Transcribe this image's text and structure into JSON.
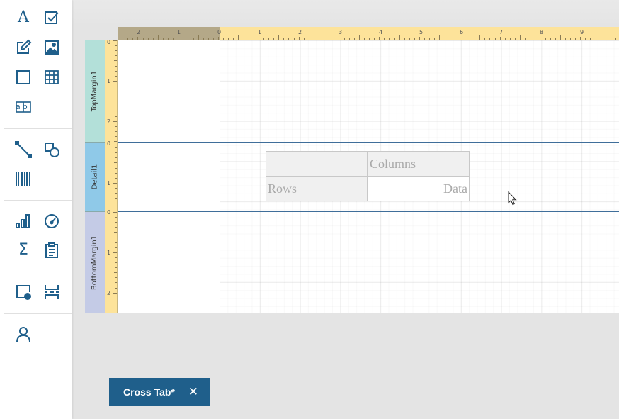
{
  "toolbox": {
    "groups": [
      [
        "label-icon",
        "checkbox-icon",
        "richtext-icon",
        "picture-icon",
        "panel-icon",
        "table-icon",
        "character-comb-icon"
      ],
      [
        "line-icon",
        "shape-icon",
        "barcode-icon"
      ],
      [
        "chart-icon",
        "gauge-icon",
        "summary-icon",
        "pivot-grid-icon"
      ],
      [
        "page-info-icon",
        "page-break-icon"
      ],
      [
        "user-icon"
      ]
    ],
    "label_glyph": "A",
    "charcomb_glyph": "ab",
    "summary_glyph": "Σ",
    "accent": "#1f5f8b"
  },
  "ruler": {
    "h_margin_labels": [
      "2",
      "1"
    ],
    "h_labels": [
      "0",
      "1",
      "2",
      "3",
      "4",
      "5",
      "6",
      "7",
      "8",
      "9"
    ],
    "top_margin_labels": [
      "0",
      "1",
      "2"
    ],
    "detail_labels": [
      "0",
      "1"
    ],
    "bottom_margin_labels": [
      "0",
      "1",
      "2"
    ],
    "color": "#fde39a"
  },
  "bands": {
    "top_margin": {
      "label": "TopMargin1",
      "color": "#b3e0d9"
    },
    "detail": {
      "label": "Detail1",
      "color": "#8fc9e8"
    },
    "bottom_margin": {
      "label": "BottomMargin1",
      "color": "#c4cbe6"
    }
  },
  "crosstab": {
    "columns_label": "Columns",
    "rows_label": "Rows",
    "data_label": "Data"
  },
  "tab": {
    "label": "Cross Tab*",
    "close_glyph": "✕"
  }
}
